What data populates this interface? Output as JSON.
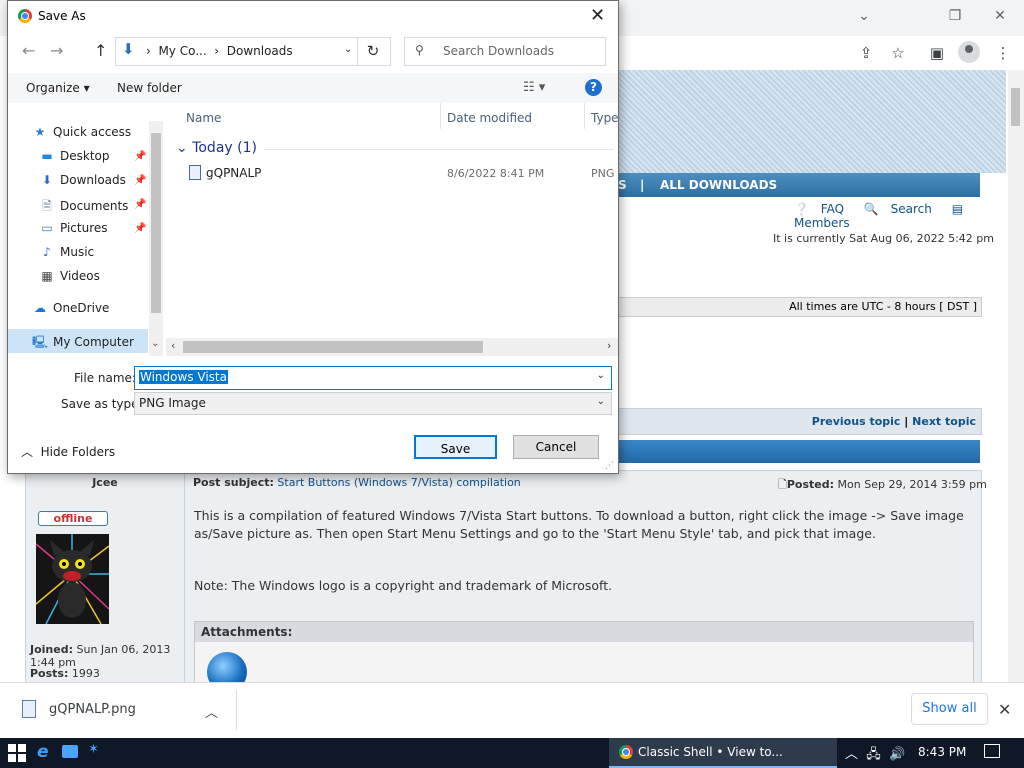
{
  "browser": {
    "controls": {
      "minimize": "⌄",
      "restore": "❐",
      "close": "✕"
    },
    "toolbar_icons": [
      "share-icon",
      "star-icon",
      "sidebar-icon",
      "profile-avatar",
      "more-icon"
    ]
  },
  "page": {
    "nav_partial": "S",
    "nav_separator": "|",
    "nav_all_downloads": "ALL DOWNLOADS",
    "quick_links": {
      "faq": "FAQ",
      "search": "Search",
      "members": "Members"
    },
    "current_time": "It is currently Sat Aug 06, 2022 5:42 pm",
    "timezone": "All times are UTC - 8 hours [ DST ]",
    "previous_topic": "Previous topic",
    "topic_nav_separator": "|",
    "next_topic": "Next topic",
    "post": {
      "author": "Jcee",
      "status": "offline",
      "joined_label": "Joined:",
      "joined": "Sun Jan 06, 2013 1:44 pm",
      "posts_label": "Posts:",
      "posts": "1993",
      "subject_label": "Post subject:",
      "subject": "Start Buttons (Windows 7/Vista) compilation",
      "posted_label": "Posted:",
      "posted": "Mon Sep 29, 2014 3:59 pm",
      "body": "This is a compilation of featured Windows 7/Vista Start buttons. To download a button, right click the image -> Save image as/Save picture as. Then open Start Menu Settings and go to the 'Start Menu Style' tab, and pick that image.",
      "note": "Note: The Windows logo is a copyright and trademark of Microsoft.",
      "attachments_label": "Attachments:"
    }
  },
  "dialog": {
    "title": "Save As",
    "breadcrumb": [
      "My Co...",
      "Downloads"
    ],
    "search_placeholder": "Search Downloads",
    "organize": "Organize",
    "new_folder": "New folder",
    "nav_items": [
      {
        "label": "Quick access",
        "icon": "star-icon"
      },
      {
        "label": "Desktop",
        "icon": "desktop-icon"
      },
      {
        "label": "Downloads",
        "icon": "download-arrow-icon"
      },
      {
        "label": "Documents",
        "icon": "document-icon"
      },
      {
        "label": "Pictures",
        "icon": "pictures-icon"
      },
      {
        "label": "Music",
        "icon": "music-icon"
      },
      {
        "label": "Videos",
        "icon": "videos-icon"
      },
      {
        "label": "OneDrive",
        "icon": "cloud-icon"
      },
      {
        "label": "My Computer",
        "icon": "computer-icon"
      }
    ],
    "columns": {
      "name": "Name",
      "date": "Date modified",
      "type": "Type"
    },
    "group": "Today (1)",
    "file": {
      "name": "gQPNALP",
      "date": "8/6/2022 8:41 PM",
      "type": "PNG"
    },
    "file_name_label": "File name:",
    "file_name_value": "Windows Vista",
    "save_type_label": "Save as type:",
    "save_type_value": "PNG Image",
    "hide_folders": "Hide Folders",
    "save": "Save",
    "cancel": "Cancel"
  },
  "downloads_bar": {
    "file": "gQPNALP.png",
    "show_all": "Show all"
  },
  "taskbar": {
    "active_window": "Classic Shell • View to...",
    "time": "8:43 PM"
  },
  "colors": {
    "accent": "#0078d7",
    "forum_link": "#105289",
    "forum_header": "#2e6fa3"
  }
}
